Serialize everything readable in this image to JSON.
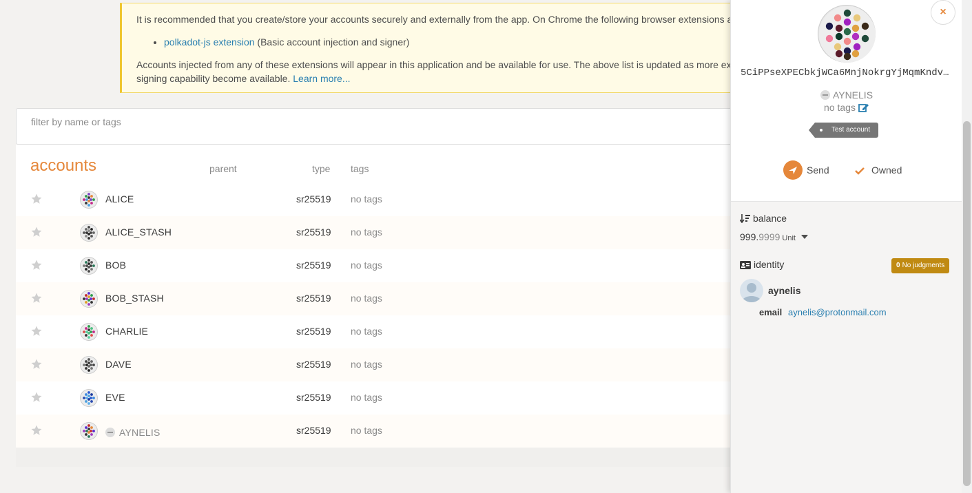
{
  "banner": {
    "text1": "It is recommended that you create/store your accounts securely and externally from the app. On Chrome the following browser extensions are available for use -",
    "ext_link": "polkadot-js extension",
    "ext_desc": " (Basic account injection and signer)",
    "text2": "Accounts injected from any of these extensions will appear in this application and be available for use. The above list is updated as more extensions with external signing capability become available. ",
    "learn_more": "Learn more..."
  },
  "filter": {
    "placeholder": "filter by name or tags"
  },
  "table": {
    "title": "accounts",
    "col_parent": "parent",
    "col_type": "type",
    "col_tags": "tags",
    "rows": [
      {
        "name": "ALICE",
        "type": "sr25519",
        "tags": "no tags"
      },
      {
        "name": "ALICE_STASH",
        "type": "sr25519",
        "tags": "no tags"
      },
      {
        "name": "BOB",
        "type": "sr25519",
        "tags": "no tags"
      },
      {
        "name": "BOB_STASH",
        "type": "sr25519",
        "tags": "no tags"
      },
      {
        "name": "CHARLIE",
        "type": "sr25519",
        "tags": "no tags"
      },
      {
        "name": "DAVE",
        "type": "sr25519",
        "tags": "no tags"
      },
      {
        "name": "EVE",
        "type": "sr25519",
        "tags": "no tags"
      },
      {
        "name": "AYNELIS",
        "type": "sr25519",
        "tags": "no tags"
      }
    ]
  },
  "panel": {
    "close_label": "×",
    "address": "5CiPPseXPECbkjWCa6MnjNokrgYjMqmKndv…",
    "account_name": "AYNELIS",
    "no_tags": "no tags",
    "test_tag": "Test account",
    "send_label": "Send",
    "owned_label": "Owned",
    "balance_label": "balance",
    "balance_int": "999.",
    "balance_dec": "9999",
    "balance_unit": "Unit",
    "identity_label": "identity",
    "judgments_count": "0",
    "judgments_label": "No judgments",
    "identity_name": "aynelis",
    "email_label": "email",
    "email_value": "aynelis@protonmail.com"
  },
  "colors": {
    "accent": "#e5873a",
    "link": "#2a7fb0",
    "banner_bg": "#fffbe6",
    "banner_border": "#efc62f",
    "judgment_badge": "#c08a12",
    "tag_bg": "#767676"
  },
  "icons": [
    "star-icon",
    "identicon",
    "close-icon",
    "edit-icon",
    "send-icon",
    "check-icon",
    "sort-icon",
    "id-card-icon",
    "user-avatar-icon",
    "caret-down-icon"
  ]
}
